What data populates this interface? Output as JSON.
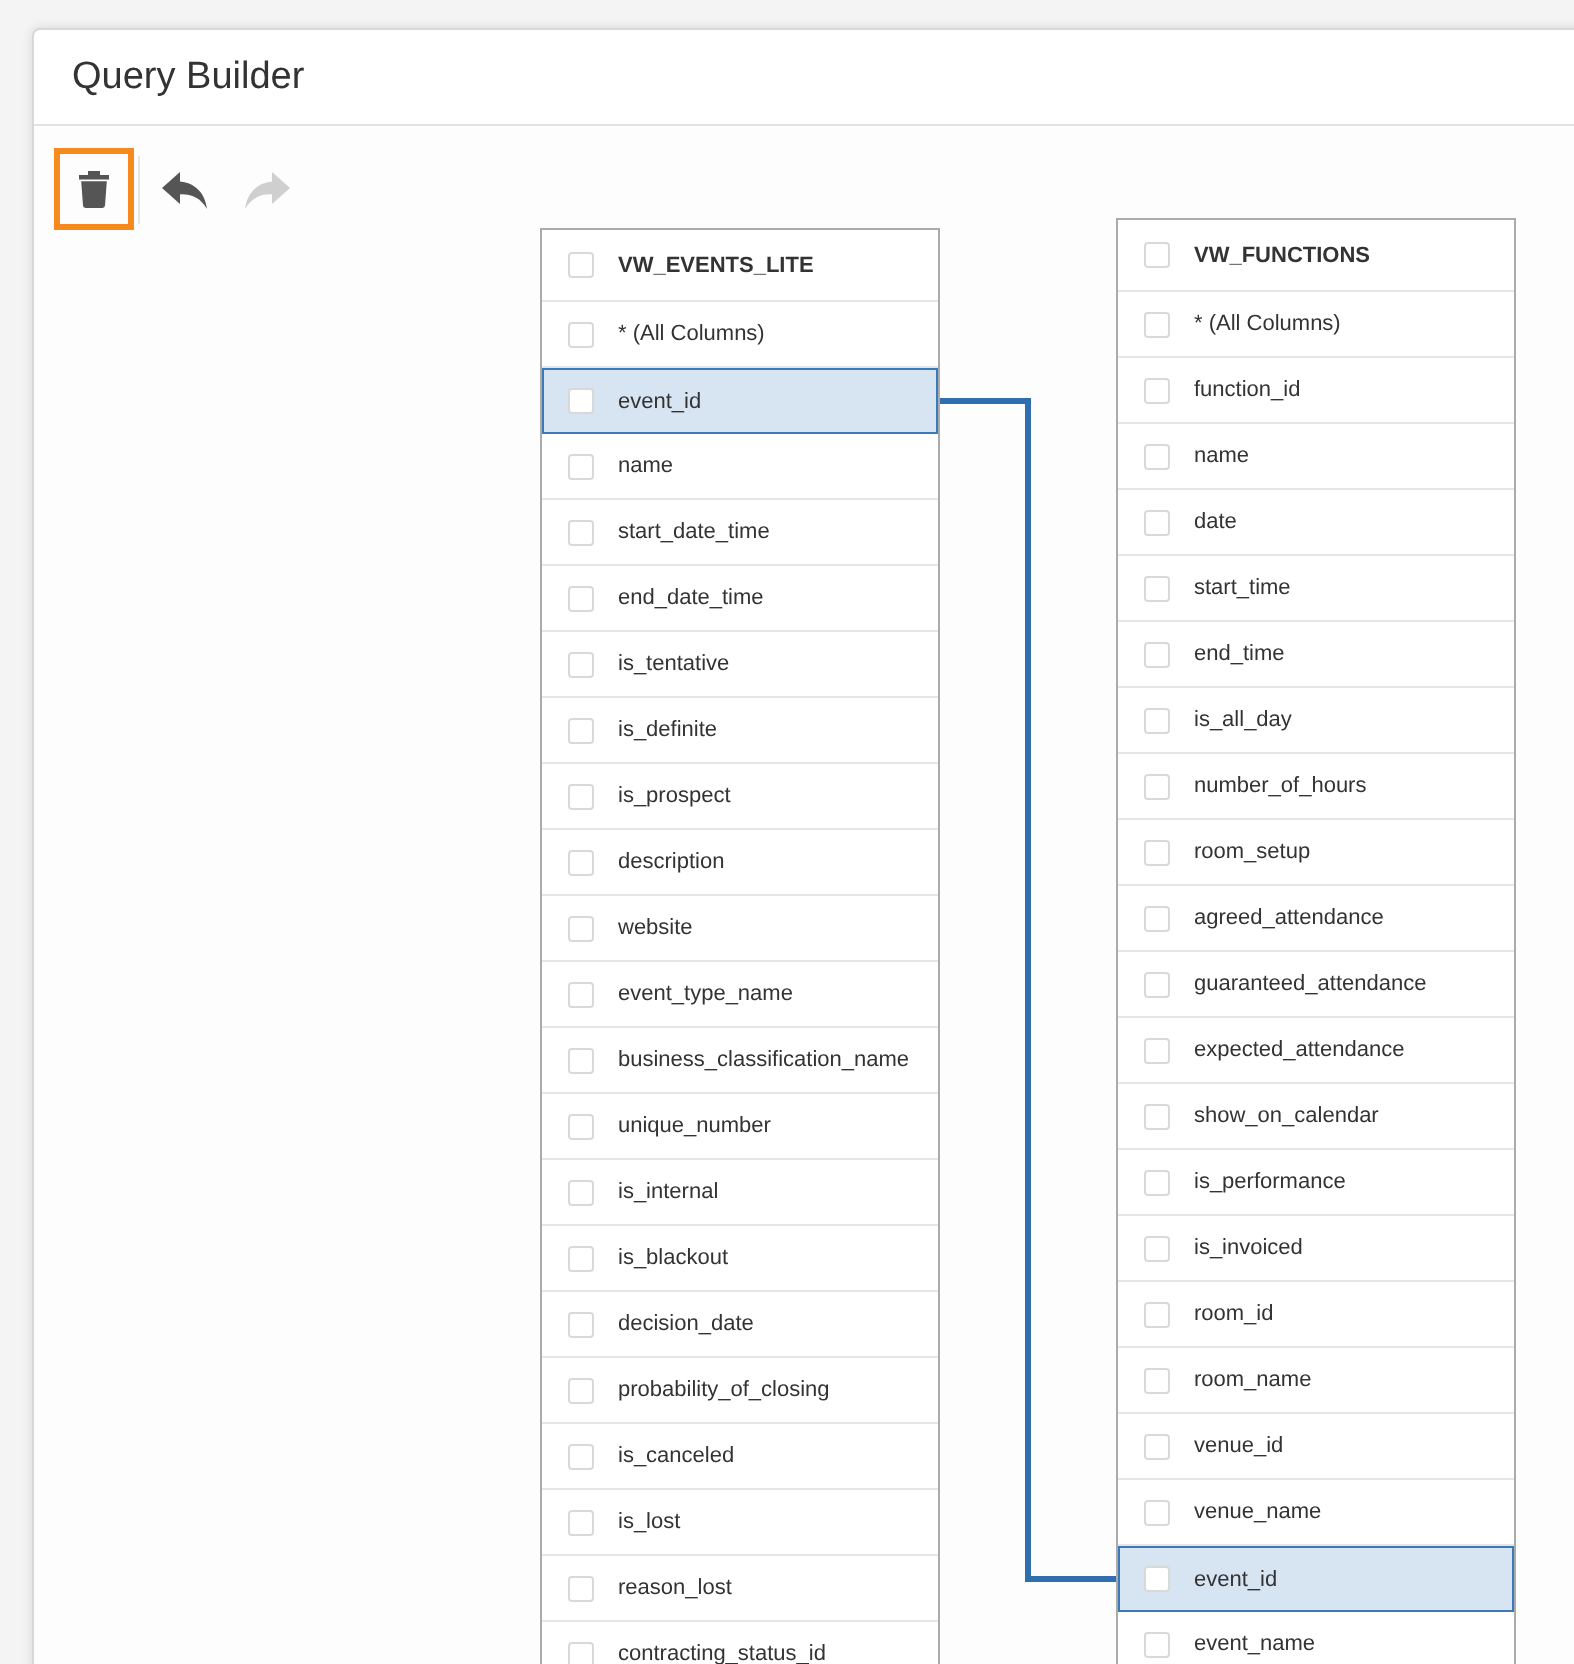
{
  "window": {
    "title": "Query Builder"
  },
  "toolbar": [
    {
      "kind": "delete",
      "focused": true,
      "disabled": false
    },
    {
      "kind": "undo",
      "focused": false,
      "disabled": false
    },
    {
      "kind": "redo",
      "focused": false,
      "disabled": true
    }
  ],
  "tables": [
    {
      "name": "VW_EVENTS_LITE",
      "checked": false,
      "columns": [
        {
          "label": "* (All Columns)",
          "checked": false,
          "selected": false
        },
        {
          "label": "event_id",
          "checked": false,
          "selected": true
        },
        {
          "label": "name",
          "checked": false,
          "selected": false
        },
        {
          "label": "start_date_time",
          "checked": false,
          "selected": false
        },
        {
          "label": "end_date_time",
          "checked": false,
          "selected": false
        },
        {
          "label": "is_tentative",
          "checked": false,
          "selected": false
        },
        {
          "label": "is_definite",
          "checked": false,
          "selected": false
        },
        {
          "label": "is_prospect",
          "checked": false,
          "selected": false
        },
        {
          "label": "description",
          "checked": false,
          "selected": false
        },
        {
          "label": "website",
          "checked": false,
          "selected": false
        },
        {
          "label": "event_type_name",
          "checked": false,
          "selected": false
        },
        {
          "label": "business_classification_name",
          "checked": false,
          "selected": false
        },
        {
          "label": "unique_number",
          "checked": false,
          "selected": false
        },
        {
          "label": "is_internal",
          "checked": false,
          "selected": false
        },
        {
          "label": "is_blackout",
          "checked": false,
          "selected": false
        },
        {
          "label": "decision_date",
          "checked": false,
          "selected": false
        },
        {
          "label": "probability_of_closing",
          "checked": false,
          "selected": false
        },
        {
          "label": "is_canceled",
          "checked": false,
          "selected": false
        },
        {
          "label": "is_lost",
          "checked": false,
          "selected": false
        },
        {
          "label": "reason_lost",
          "checked": false,
          "selected": false
        },
        {
          "label": "contracting_status_id",
          "checked": false,
          "selected": false
        }
      ]
    },
    {
      "name": "VW_FUNCTIONS",
      "checked": false,
      "columns": [
        {
          "label": "* (All Columns)",
          "checked": false,
          "selected": false
        },
        {
          "label": "function_id",
          "checked": false,
          "selected": false
        },
        {
          "label": "name",
          "checked": false,
          "selected": false
        },
        {
          "label": "date",
          "checked": false,
          "selected": false
        },
        {
          "label": "start_time",
          "checked": false,
          "selected": false
        },
        {
          "label": "end_time",
          "checked": false,
          "selected": false
        },
        {
          "label": "is_all_day",
          "checked": false,
          "selected": false
        },
        {
          "label": "number_of_hours",
          "checked": false,
          "selected": false
        },
        {
          "label": "room_setup",
          "checked": false,
          "selected": false
        },
        {
          "label": "agreed_attendance",
          "checked": false,
          "selected": false
        },
        {
          "label": "guaranteed_attendance",
          "checked": false,
          "selected": false
        },
        {
          "label": "expected_attendance",
          "checked": false,
          "selected": false
        },
        {
          "label": "show_on_calendar",
          "checked": false,
          "selected": false
        },
        {
          "label": "is_performance",
          "checked": false,
          "selected": false
        },
        {
          "label": "is_invoiced",
          "checked": false,
          "selected": false
        },
        {
          "label": "room_id",
          "checked": false,
          "selected": false
        },
        {
          "label": "room_name",
          "checked": false,
          "selected": false
        },
        {
          "label": "venue_id",
          "checked": false,
          "selected": false
        },
        {
          "label": "venue_name",
          "checked": false,
          "selected": false
        },
        {
          "label": "event_id",
          "checked": false,
          "selected": true
        },
        {
          "label": "event_name",
          "checked": false,
          "selected": false
        }
      ]
    }
  ]
}
